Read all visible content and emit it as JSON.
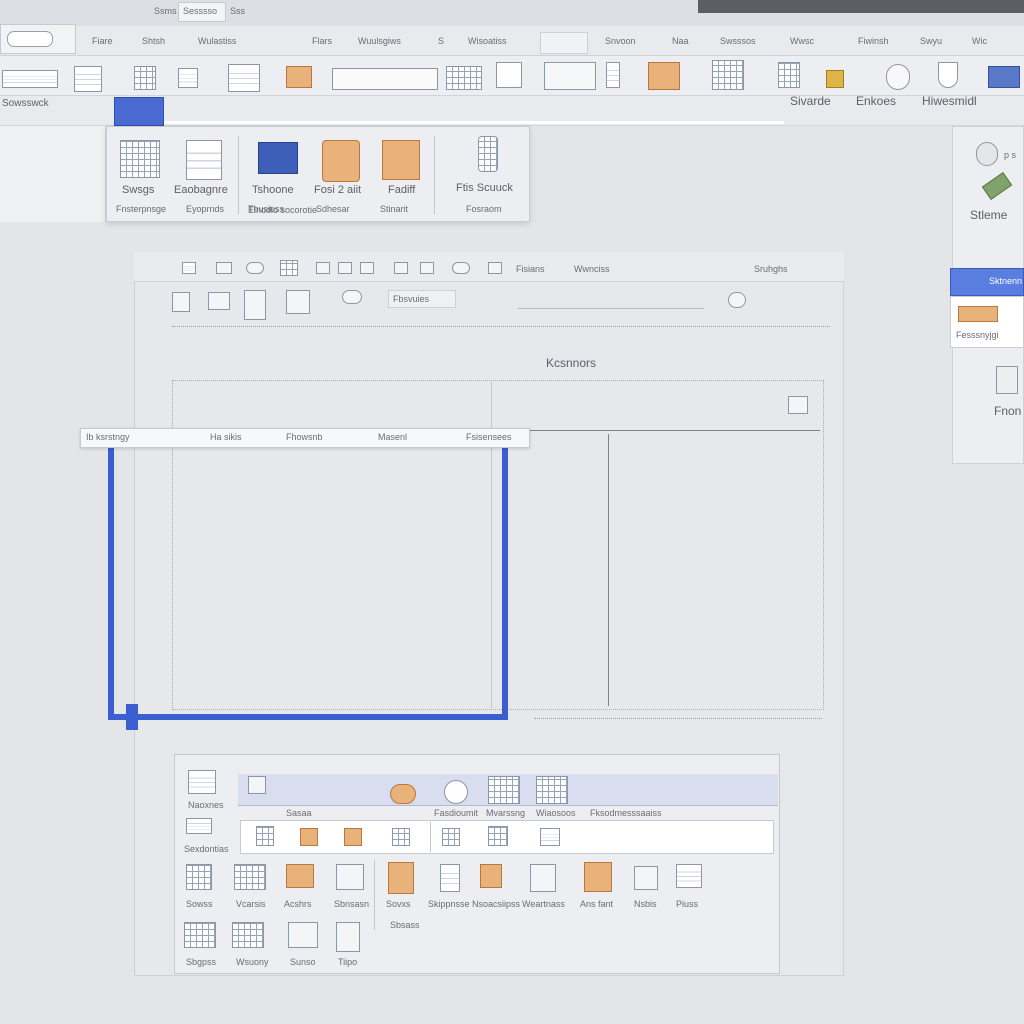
{
  "colors": {
    "accent_blue": "#3b5fcf",
    "ribbon_bg": "#eceef1",
    "canvas_bg": "#e3e5e9",
    "dark_strip": "#5b5e63"
  },
  "titlebar": {
    "tab_left": "Ssms",
    "tab_active": "Sesssso"
  },
  "menubar": {
    "items": [
      "Fiare",
      "Shtsh",
      "Wulastiss",
      "Flars",
      "Wuulsgiws",
      "S",
      "Wisoatiss",
      "Snvoon",
      "Naa",
      "Swsssos",
      "Wwsc",
      "Fiwinsh",
      "Swyu",
      "Wic"
    ]
  },
  "app_button": {
    "icon": "office-icon"
  },
  "quickaccess": {
    "label": "Sowsswck"
  },
  "ribbon_right": {
    "labels": [
      "Sivarde",
      "Enkoes",
      "Hiwesmidl"
    ]
  },
  "popup_gallery": {
    "items": [
      {
        "label": "Swsgs",
        "sub": "Fnsterpnsge",
        "icon": "grid-doc-icon"
      },
      {
        "label": "Eaobagnre",
        "sub": "Eyoprnds",
        "icon": "document-icon"
      },
      {
        "label": "Tshoone",
        "sub": "Thusiuss",
        "icon": "picture-icon"
      },
      {
        "label": "Fosi 2 aiit",
        "sub": "Sdhesar",
        "icon": "shapes-icon"
      },
      {
        "label": "Fadiff",
        "sub": "Stinarit",
        "icon": "chart-icon"
      },
      {
        "label": "Ftis Scuuck",
        "sub": "Fosraom",
        "icon": "smartart-icon"
      }
    ],
    "footer": "Elnodlo socorotie"
  },
  "right_panel": {
    "label": "Stleme",
    "header": "Sktnenn",
    "item": "Fesssnyjgi",
    "bottom": "Fnon"
  },
  "inner_window": {
    "toolbar_labels": [
      "Fisians",
      "Wwnciss"
    ],
    "toolbar_right": "Sruhghs",
    "field_text": "Fbsvuies",
    "sheet_heading": "Kcsnnors"
  },
  "floating_toolbar": {
    "items": [
      "Ib ksrstngy",
      "Ha sikis",
      "Fhowsnb",
      "Masenl",
      "Fsisensees"
    ]
  },
  "bottom_dialog": {
    "side_labels": [
      "Naoxnes",
      "Sexdontias"
    ],
    "header_labels": [
      "Sasaa",
      "Fasdioumit",
      "Mvarssng",
      "Wiaosoos",
      "Fksodmesssaaiss"
    ],
    "row1_labels": [
      "Sowss",
      "Vcarsis",
      "Acshrs",
      "Sbnsasn",
      "Sovxs",
      "Skippnsse",
      "Nsoacsiipss",
      "Weartnass",
      "Ans fant",
      "Nsbis",
      "Piuss"
    ],
    "row2_labels": [
      "Sbgpss",
      "Wsuony",
      "Sunso",
      "Tiipo"
    ],
    "extra_label": "Sbsass"
  }
}
